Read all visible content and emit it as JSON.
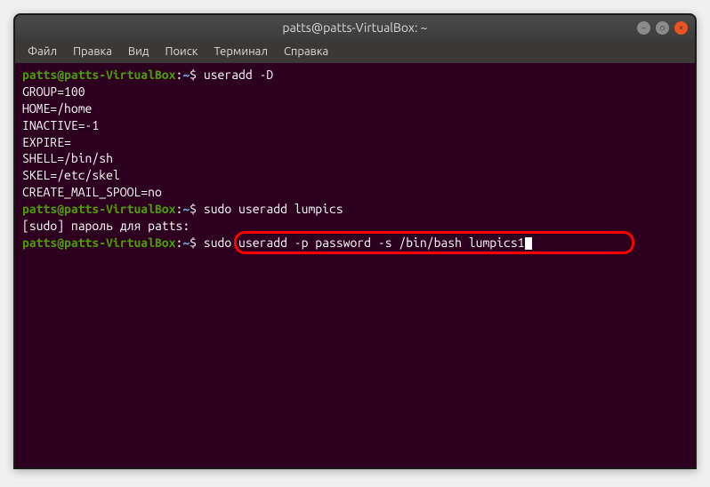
{
  "titlebar": {
    "text": "patts@patts-VirtualBox: ~"
  },
  "menubar": {
    "items": [
      "Файл",
      "Правка",
      "Вид",
      "Поиск",
      "Терминал",
      "Справка"
    ]
  },
  "terminal": {
    "lines": [
      {
        "type": "prompt",
        "user": "patts@patts-VirtualBox",
        "path": "~",
        "cmd": "useradd -D"
      },
      {
        "type": "output",
        "text": "GROUP=100"
      },
      {
        "type": "output",
        "text": "HOME=/home"
      },
      {
        "type": "output",
        "text": "INACTIVE=-1"
      },
      {
        "type": "output",
        "text": "EXPIRE="
      },
      {
        "type": "output",
        "text": "SHELL=/bin/sh"
      },
      {
        "type": "output",
        "text": "SKEL=/etc/skel"
      },
      {
        "type": "output",
        "text": "CREATE_MAIL_SPOOL=no"
      },
      {
        "type": "prompt",
        "user": "patts@patts-VirtualBox",
        "path": "~",
        "cmd": "sudo useradd lumpics"
      },
      {
        "type": "output",
        "text": "[sudo] пароль для patts: "
      },
      {
        "type": "prompt",
        "user": "patts@patts-VirtualBox",
        "path": "~",
        "cmd": "sudo useradd -p password -s /bin/bash lumpics1",
        "highlighted": true,
        "cursor": true
      }
    ]
  },
  "icons": {
    "minimize": "−",
    "maximize": "○",
    "close": "×"
  }
}
